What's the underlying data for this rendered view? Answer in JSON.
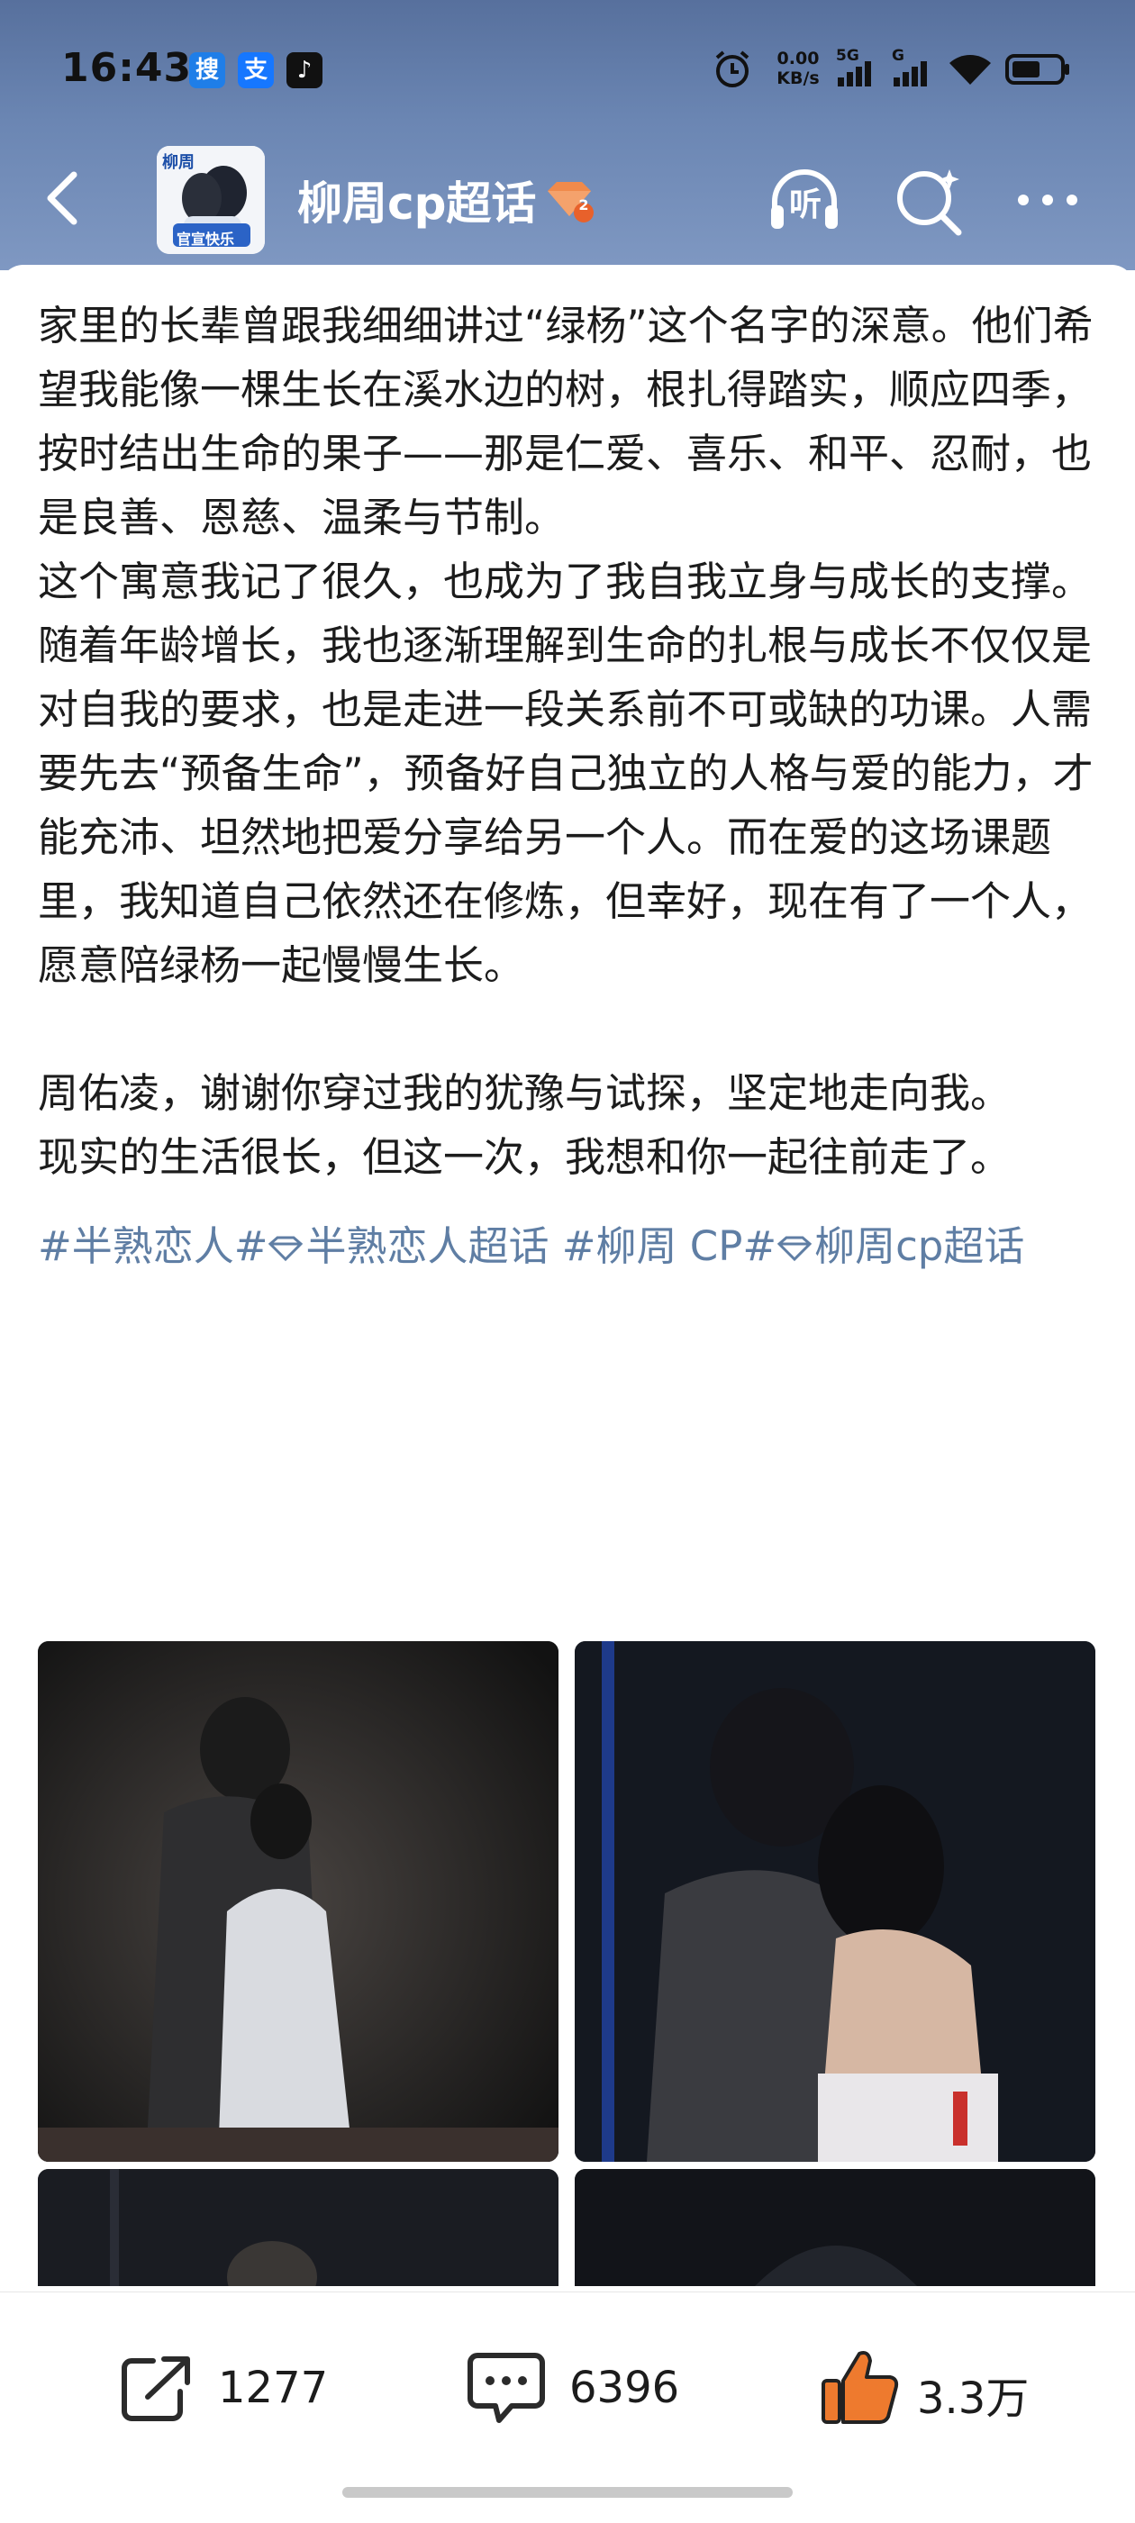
{
  "status_bar": {
    "time": "16:43",
    "apps": [
      "搜",
      "支",
      "♪"
    ],
    "net_speed_value": "0.00",
    "net_speed_unit": "KB/s",
    "signal_5g": "5G",
    "signal_g": "G"
  },
  "nav": {
    "title": "柳周cp超话",
    "avatar_text": [
      "柳周",
      "官宣快乐"
    ],
    "level": "2",
    "listen_label": "听"
  },
  "post": {
    "paragraphs": [
      "家里的长辈曾跟我细细讲过“绿杨”这个名字的深意。他们希望我能像一棵生长在溪水边的树，根扎得踏实，顺应四季，按时结出生命的果子——那是仁爱、喜乐、和平、忍耐，也是良善、恩慈、温柔与节制。",
      "这个寓意我记了很久，也成为了我自我立身与成长的支撑。随着年龄增长，我也逐渐理解到生命的扎根与成长不仅仅是对自我的要求，也是走进一段关系前不可或缺的功课。人需要先去“预备生命”，预备好自己独立的人格与爱的能力，才能充沛、坦然地把爱分享给另一个人。而在爱的这场课题里，我知道自己依然还在修炼，但幸好，现在有了一个人，愿意陪绿杨一起慢慢生长。",
      "周佑凌，谢谢你穿过我的犹豫与试探，坚定地走向我。",
      "现实的生活很长，但这一次，我想和你一起往前走了。"
    ],
    "tags": [
      {
        "text": "#半熟恋人",
        "gem": false
      },
      {
        "text": "半熟恋人超话",
        "gem": true
      },
      {
        "text": "#柳周 CP",
        "gem": false
      },
      {
        "text": "柳周cp超话",
        "gem": true
      }
    ],
    "image_count": 4
  },
  "actions": {
    "share_count": "1277",
    "comment_count": "6396",
    "like_count": "3.3万"
  },
  "colors": {
    "header_top": "#57709d",
    "header_bottom": "#7f98c2",
    "tag": "#5f7ea4",
    "like_accent": "#ee7a2e",
    "text": "#1c1c1c"
  },
  "icons": [
    "back-arrow-icon",
    "listen-headphone-icon",
    "search-icon",
    "more-icon",
    "share-icon",
    "comment-icon",
    "like-thumb-icon",
    "alarm-icon",
    "wifi-icon",
    "battery-icon",
    "level-gem-icon"
  ]
}
